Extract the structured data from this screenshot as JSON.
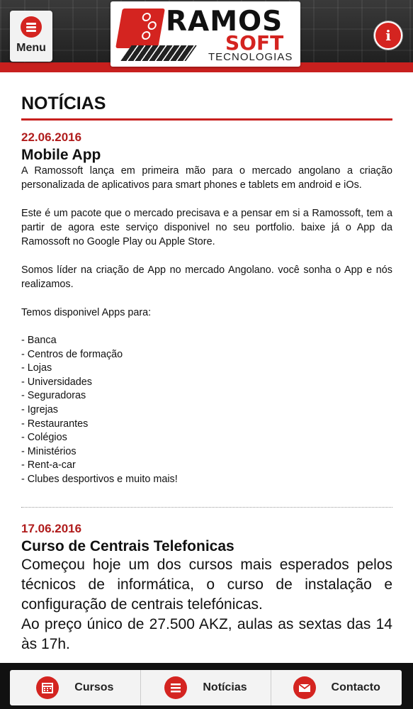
{
  "header": {
    "menu_label": "Menu",
    "logo_text_1": "RAMOS",
    "logo_text_2": "SOFT",
    "logo_text_3": "TECNOLOGIAS",
    "info_icon": "i"
  },
  "page": {
    "title": "NOTÍCIAS"
  },
  "news": [
    {
      "date": "22.06.2016",
      "title": "Mobile App",
      "paragraphs": [
        "A Ramossoft lança em primeira mão para o mercado angolano a criação personalizada de aplicativos para smart phones e tablets em android e iOs.",
        "Este é um pacote que o mercado precisava e a pensar em si a Ramossoft, tem a partir de agora este serviço disponivel no seu portfolio. baixe já o App da Ramossoft no Google Play ou Apple Store.",
        "Somos líder na criação de App no mercado Angolano. você sonha o App e nós realizamos.",
        "Temos disponivel Apps para:"
      ],
      "list": [
        "- Banca",
        "- Centros de formação",
        "- Lojas",
        "- Universidades",
        "- Seguradoras",
        "- Igrejas",
        "- Restaurantes",
        "- Colégios",
        "- Ministérios",
        "- Rent-a-car",
        "- Clubes desportivos e muito mais!"
      ]
    },
    {
      "date": "17.06.2016",
      "title": "Curso de Centrais Telefonicas",
      "paragraphs": [
        "Começou hoje um dos cursos mais esperados pelos técnicos de informática, o curso de instalação e configuração de centrais telefónicas.",
        "Ao preço único de 27.500 AKZ, aulas as sextas das 14 às 17h."
      ]
    }
  ],
  "footer": {
    "tabs": [
      {
        "label": "Cursos",
        "icon": "calendar-icon"
      },
      {
        "label": "Notícias",
        "icon": "list-icon"
      },
      {
        "label": "Contacto",
        "icon": "mail-icon"
      }
    ]
  },
  "colors": {
    "accent": "#c8201e",
    "header_bg": "#2a2a2a",
    "footer_bg": "#111111"
  }
}
